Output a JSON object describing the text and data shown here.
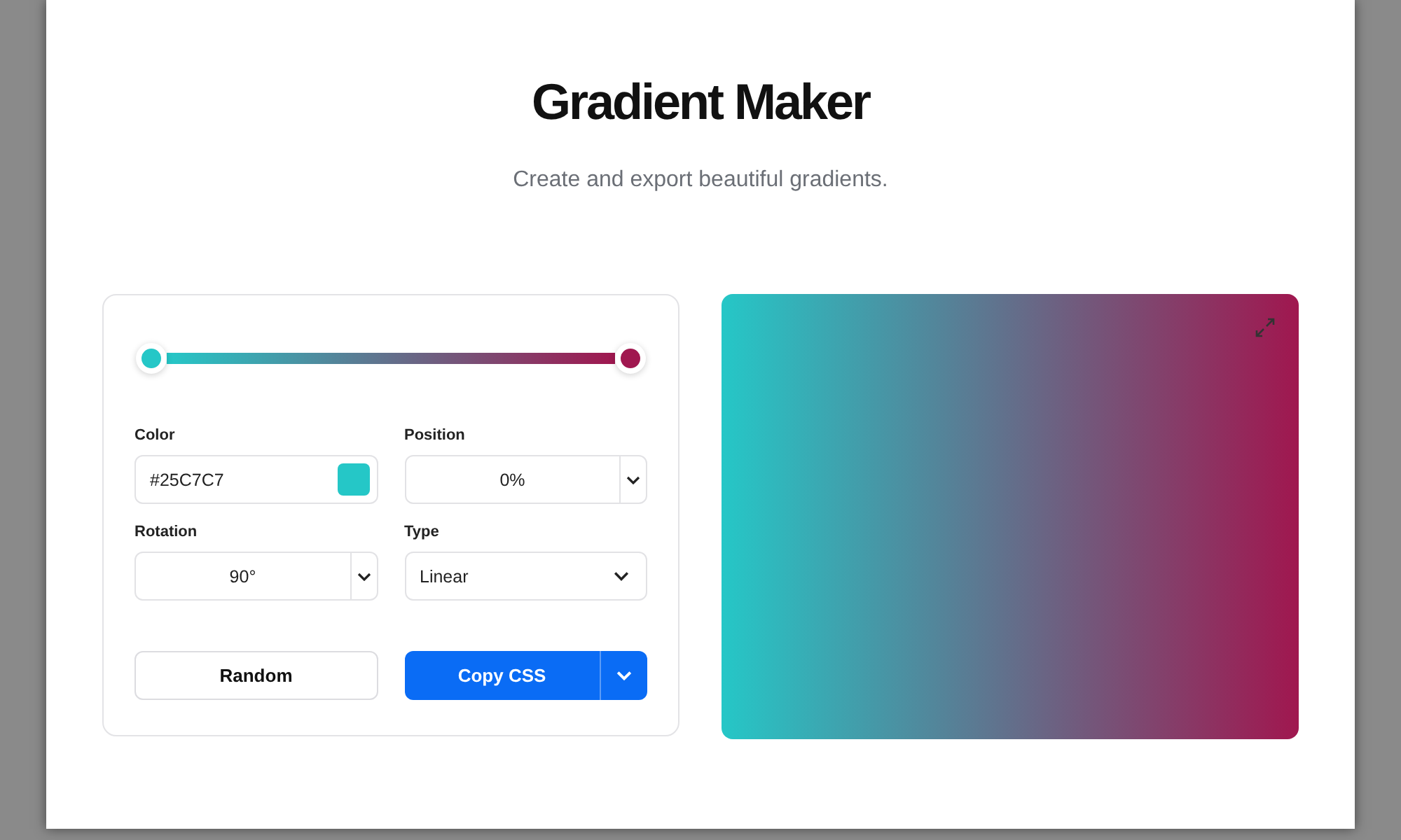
{
  "title": "Gradient Maker",
  "subtitle": "Create and export beautiful gradients.",
  "stops": [
    {
      "color": "#25c7c7",
      "level": 0
    },
    {
      "color": "#a0174f",
      "level": 1
    }
  ],
  "color_field": {
    "label": "Color",
    "value": "#25C7C7"
  },
  "position_field": {
    "label": "Position",
    "value": "0%"
  },
  "rotation_field": {
    "label": "Rotation",
    "value": "90°"
  },
  "type_field": {
    "label": "Type",
    "value": "Linear"
  },
  "buttons": {
    "random": "Random",
    "copy": "Copy CSS"
  }
}
